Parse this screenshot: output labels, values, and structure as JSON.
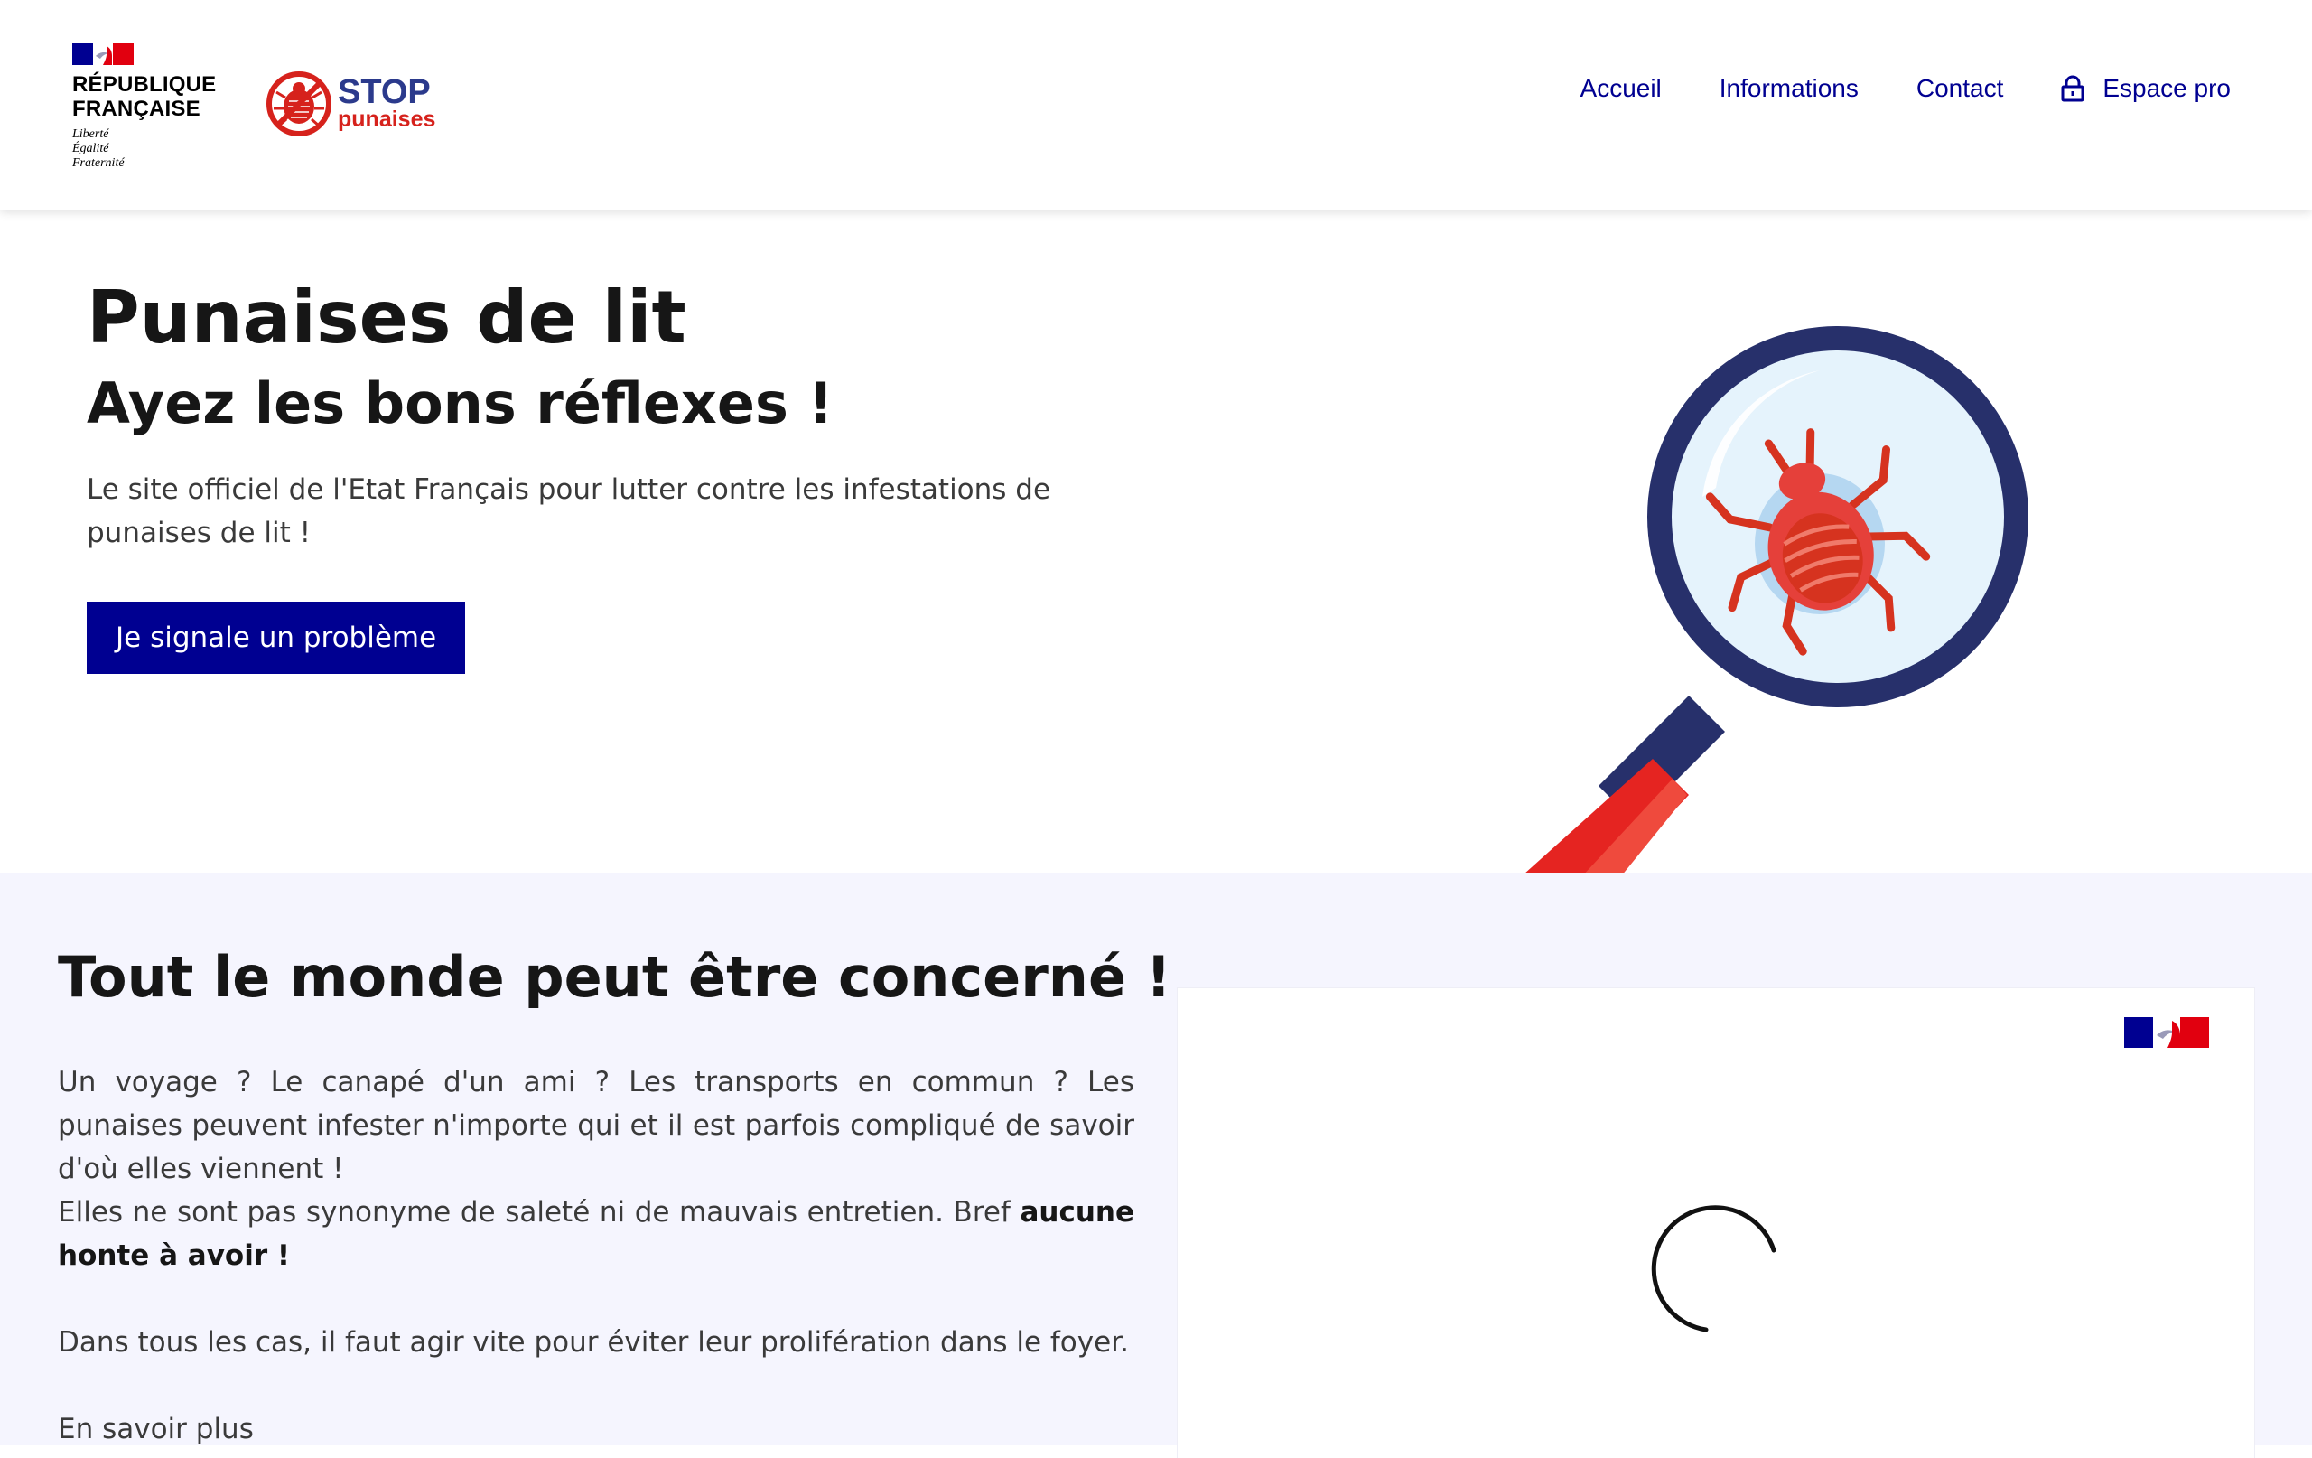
{
  "header": {
    "republic_line1": "RÉPUBLIQUE",
    "republic_line2": "FRANÇAISE",
    "motto": [
      "Liberté",
      "Égalité",
      "Fraternité"
    ],
    "site_logo_word": "STOP",
    "site_logo_sub": "punaises",
    "nav": [
      {
        "label": "Accueil"
      },
      {
        "label": "Informations"
      },
      {
        "label": "Contact"
      },
      {
        "label": "Espace pro",
        "icon": "lock-icon"
      }
    ]
  },
  "hero": {
    "title": "Punaises de lit",
    "subtitle": "Ayez les bons réflexes !",
    "description": "Le site officiel de l'Etat Français pour lutter contre les infestations de punaises de lit !",
    "cta_label": "Je signale un problème",
    "illustration": "magnifier-bedbug-illustration"
  },
  "concerned": {
    "title": "Tout le monde peut être concerné !",
    "paragraph1": "Un voyage ? Le canapé d'un ami ? Les transports en commun ? Les punaises peuvent infester n'importe qui et il est parfois compliqué de savoir d'où elles viennent !",
    "paragraph2_start": "Elles ne sont pas synonyme de saleté ni de mauvais entretien. Bref ",
    "paragraph2_bold": "aucune honte à avoir !",
    "paragraph3": "Dans tous les cas, il faut agir vite pour éviter leur prolifération dans le foyer.",
    "more_link": "En savoir plus",
    "video_state": "loading"
  },
  "colors": {
    "primary_blue": "#000091",
    "flag_blue": "#000091",
    "flag_red": "#e1000f",
    "stop_red": "#d6221c",
    "stop_navy": "#2b3a8c",
    "section_bg": "#f5f5fe"
  }
}
